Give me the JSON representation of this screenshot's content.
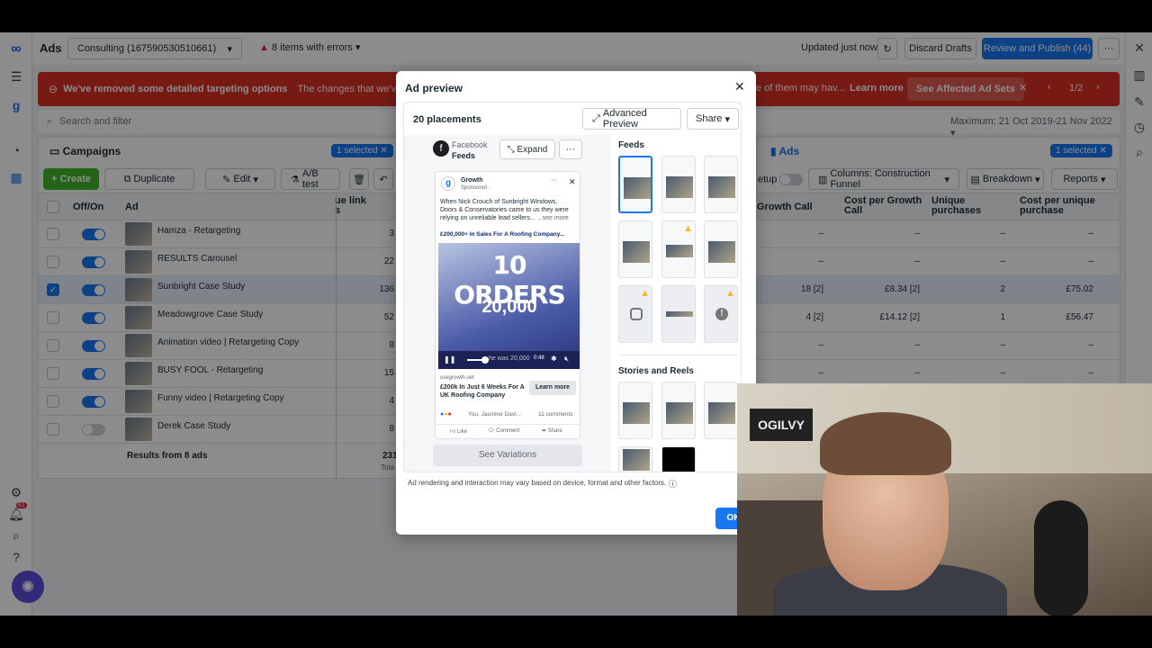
{
  "topbar": {
    "app_title": "Ads",
    "account": "Consulting (167590530510661)",
    "errors": "8 items with errors",
    "updated": "Updated just now",
    "discard": "Discard Drafts",
    "publish": "Review and Publish (44)"
  },
  "banner": {
    "title": "We've removed some detailed targeting options",
    "text": "The changes that we've made to detaile",
    "text_tail": "e of them may hav...",
    "learn_more": "Learn more",
    "see_affected": "See Affected Ad Sets",
    "page": "1/2"
  },
  "search": {
    "placeholder": "Search and filter",
    "date_range": "Maximum: 21 Oct 2019-21 Nov 2022"
  },
  "campaigns": {
    "title": "Campaigns",
    "selected": "1 selected",
    "create": "Create",
    "duplicate": "Duplicate",
    "edit": "Edit",
    "ab_test": "A/B test"
  },
  "ads_panel": {
    "title": "Ads",
    "selected": "1 selected",
    "setup": "etup",
    "columns": "Columns: Construction Funnel",
    "breakdown": "Breakdown",
    "reports": "Reports"
  },
  "table": {
    "col_offon": "Off/On",
    "col_ad": "Ad",
    "col_link": "ue link\ns",
    "col_growth": "Growth Call",
    "col_cost_growth": "Cost per Growth Call",
    "col_unique": "Unique purchases",
    "col_cost_unique": "Cost per unique purchase",
    "rows": [
      {
        "name": "Hamza - Retargeting",
        "link": "3",
        "growth": "–",
        "cost_growth": "–",
        "unique": "–",
        "cost_unique": "–",
        "on": true,
        "checked": false
      },
      {
        "name": "RESULTS Carousel",
        "link": "22",
        "growth": "–",
        "cost_growth": "–",
        "unique": "–",
        "cost_unique": "–",
        "on": true,
        "checked": false
      },
      {
        "name": "Sunbright Case Study",
        "link": "136",
        "growth": "18 [2]",
        "cost_growth": "£8.34 [2]",
        "unique": "2",
        "cost_unique": "£75.02",
        "on": true,
        "checked": true
      },
      {
        "name": "Meadowgrove Case Study",
        "link": "52",
        "growth": "4 [2]",
        "cost_growth": "£14.12 [2]",
        "unique": "1",
        "cost_unique": "£56.47",
        "on": true,
        "checked": false
      },
      {
        "name": "Animation video | Retargeting Copy",
        "link": "8",
        "growth": "–",
        "cost_growth": "–",
        "unique": "–",
        "cost_unique": "–",
        "on": true,
        "checked": false
      },
      {
        "name": "BUSY FOOL - Retargeting",
        "link": "15",
        "growth": "–",
        "cost_growth": "–",
        "unique": "–",
        "cost_unique": "–",
        "on": true,
        "checked": false
      },
      {
        "name": "Funny video | Retargeting Copy",
        "link": "4",
        "growth": "–",
        "cost_growth": "–",
        "unique": "–",
        "cost_unique": "–",
        "on": true,
        "checked": false
      },
      {
        "name": "Derek Case Study",
        "link": "8",
        "growth": "–",
        "cost_growth": "–",
        "unique": "–",
        "cost_unique": "–",
        "on": false,
        "checked": false
      }
    ],
    "results": "Results from 8 ads",
    "results_link": "231",
    "results_total": "Tota"
  },
  "modal": {
    "title": "Ad preview",
    "placements": "20 placements",
    "advanced": "Advanced Preview",
    "share": "Share",
    "platform": "Facebook",
    "placement": "Feeds",
    "expand": "Expand",
    "post": {
      "page": "Growth",
      "sponsored": "Sponsored · ",
      "body": "When Nick Crouch of Sunbright Windows, Doors & Conservatories came to us they were relying on unreliable lead sellers...",
      "see_more": "...see more",
      "headline_top": "£200,000+ In Sales For A Roofing Company...",
      "overlay1": "10 ORDERS",
      "overlay2": "20,000",
      "caption": "he was 20,000",
      "time": "0:48",
      "domain": "usegrowth.net",
      "link_title": "£200k In Just 6 Weeks For A UK Roofing Company",
      "cta": "Learn more",
      "reactions": "You, Jasmine Davi...",
      "comments": "11 comments",
      "like": "Like",
      "comment": "Comment",
      "share": "Share"
    },
    "see_variations": "See Variations",
    "feeds": "Feeds",
    "stories": "Stories and Reels",
    "disclaimer": "Ad rendering and interaction may vary based on device, format and other factors.",
    "ok": "OK"
  },
  "webcam": {
    "poster_text": "OGILVY"
  },
  "notif_count": "61"
}
